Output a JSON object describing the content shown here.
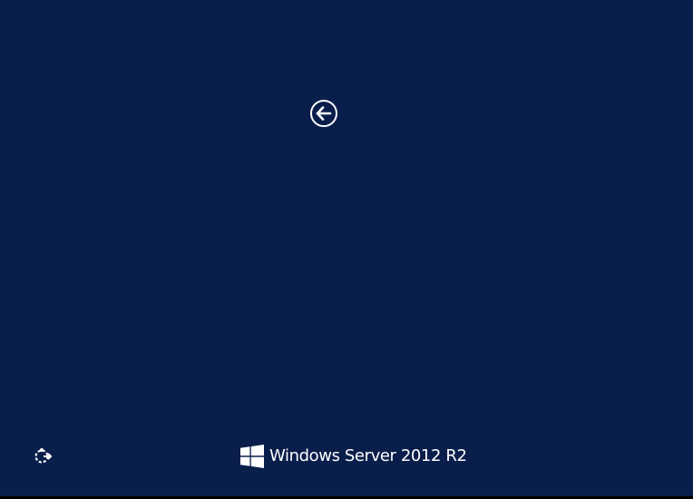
{
  "screen": {
    "background_color": "#0a1e4b",
    "text_color": "#ffffff"
  },
  "back_button": {
    "icon": "back-arrow-circle-icon"
  },
  "ease_of_access": {
    "icon": "ease-of-access-icon"
  },
  "branding": {
    "logo_icon": "windows-logo-icon",
    "product_name": "Windows Server 2012 R2"
  }
}
